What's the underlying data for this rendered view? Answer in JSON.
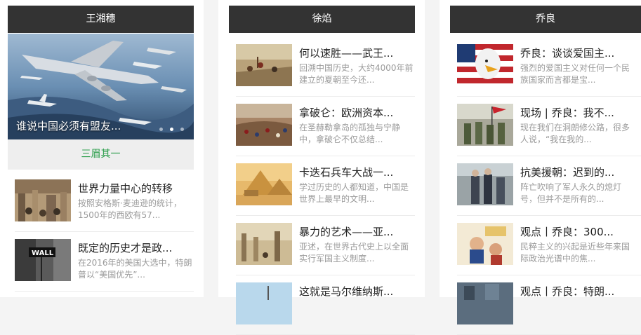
{
  "columns": [
    {
      "author": "王湘穗",
      "slider": {
        "caption": "谁说中国必须有盟友...",
        "dots": 3,
        "active_dot": 2
      },
      "author_bar": "三眉其一",
      "items": [
        {
          "title": "世界力量中心的转移",
          "desc": "按照安格斯·麦迪逊的统计，1500年的西欧有57...",
          "thumb": "trading-floor-image"
        },
        {
          "title": "既定的历史才是政...",
          "desc": "在2016年的美国大选中，特朗普以“美国优先”...",
          "thumb": "wall-street-sign-image"
        }
      ]
    },
    {
      "author": "徐焰",
      "items": [
        {
          "title": "何以速胜——武王...",
          "desc": "回溯中国历史，大约4000年前建立的夏朝至今还...",
          "thumb": "ancient-battle-painting"
        },
        {
          "title": "拿破仑：欧洲资本...",
          "desc": "在圣赫勒拿岛的孤独与宁静中，拿破仑不仅总结...",
          "thumb": "napoleon-battle-painting"
        },
        {
          "title": "卡迭石兵车大战一...",
          "desc": "学过历史的人都知道，中国是世界上最早的文明...",
          "thumb": "pyramids-sphinx-image"
        },
        {
          "title": "暴力的艺术——亚...",
          "desc": "亚述，在世界古代史上以全面实行军国主义制度...",
          "thumb": "ancient-ruins-painting"
        },
        {
          "title": "这就是马尔维纳斯...",
          "desc": "",
          "thumb": "sky-scene-image"
        }
      ]
    },
    {
      "author": "乔良",
      "items": [
        {
          "title": "乔良：谈谈爱国主...",
          "desc": "强烈的爱国主义对任何一个民族国家而言都是宝...",
          "thumb": "eagle-flag-image"
        },
        {
          "title": "现场 | 乔良：我不...",
          "desc": "现在我们在洞朗修公路，很多人说，“我在我的...",
          "thumb": "soldiers-flag-image"
        },
        {
          "title": "抗美援朝：迟到的...",
          "desc": "阵亡吹响了军人永久的熄灯号，但并不是所有的...",
          "thumb": "veterans-photo-image"
        },
        {
          "title": "观点丨乔良：300...",
          "desc": "民粹主义的兴起是近些年来国际政治光谱中的焦...",
          "thumb": "cartoon-image"
        },
        {
          "title": "观点丨乔良：特朗...",
          "desc": "",
          "thumb": "city-scene-image"
        }
      ]
    }
  ]
}
